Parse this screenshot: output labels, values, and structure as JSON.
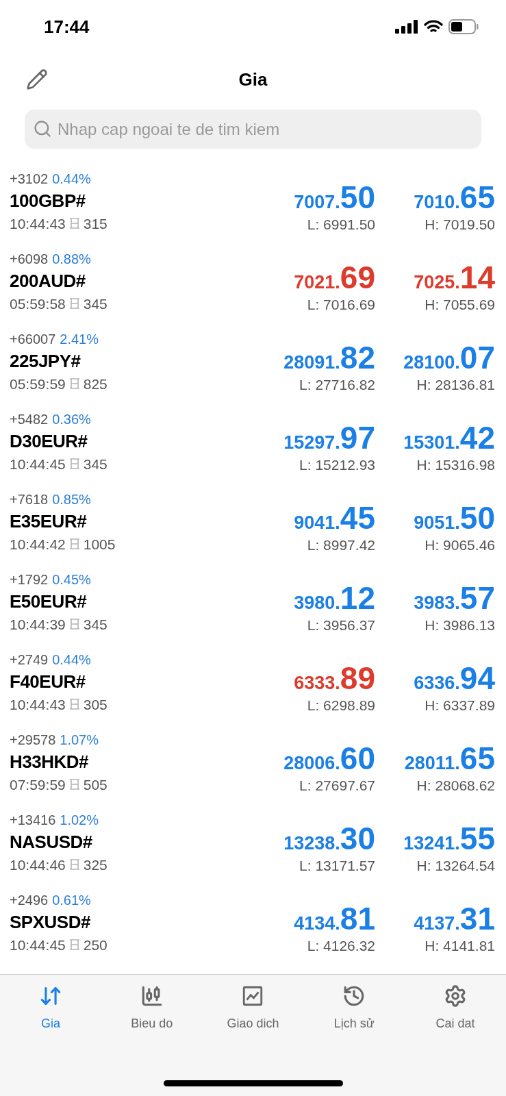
{
  "status_bar": {
    "time": "17:44"
  },
  "header": {
    "title": "Gia"
  },
  "search": {
    "placeholder": "Nhap cap ngoai te de tim kiem"
  },
  "quotes": [
    {
      "change": "+3102",
      "percent": "0.44%",
      "symbol": "100GBP#",
      "time": "10:44:43",
      "spread": "315",
      "bid": {
        "lead": "7007.",
        "big": "50",
        "rising": true
      },
      "ask": {
        "lead": "7010.",
        "big": "65",
        "rising": true
      },
      "low": "L: 6991.50",
      "high": "H: 7019.50"
    },
    {
      "change": "+6098",
      "percent": "0.88%",
      "symbol": "200AUD#",
      "time": "05:59:58",
      "spread": "345",
      "bid": {
        "lead": "7021.",
        "big": "69",
        "rising": false
      },
      "ask": {
        "lead": "7025.",
        "big": "14",
        "rising": false
      },
      "low": "L: 7016.69",
      "high": "H: 7055.69"
    },
    {
      "change": "+66007",
      "percent": "2.41%",
      "symbol": "225JPY#",
      "time": "05:59:59",
      "spread": "825",
      "bid": {
        "lead": "28091.",
        "big": "82",
        "rising": true
      },
      "ask": {
        "lead": "28100.",
        "big": "07",
        "rising": true
      },
      "low": "L: 27716.82",
      "high": "H: 28136.81"
    },
    {
      "change": "+5482",
      "percent": "0.36%",
      "symbol": "D30EUR#",
      "time": "10:44:45",
      "spread": "345",
      "bid": {
        "lead": "15297.",
        "big": "97",
        "rising": true
      },
      "ask": {
        "lead": "15301.",
        "big": "42",
        "rising": true
      },
      "low": "L: 15212.93",
      "high": "H: 15316.98"
    },
    {
      "change": "+7618",
      "percent": "0.85%",
      "symbol": "E35EUR#",
      "time": "10:44:42",
      "spread": "1005",
      "bid": {
        "lead": "9041.",
        "big": "45",
        "rising": true
      },
      "ask": {
        "lead": "9051.",
        "big": "50",
        "rising": true
      },
      "low": "L: 8997.42",
      "high": "H: 9065.46"
    },
    {
      "change": "+1792",
      "percent": "0.45%",
      "symbol": "E50EUR#",
      "time": "10:44:39",
      "spread": "345",
      "bid": {
        "lead": "3980.",
        "big": "12",
        "rising": true
      },
      "ask": {
        "lead": "3983.",
        "big": "57",
        "rising": true
      },
      "low": "L: 3956.37",
      "high": "H: 3986.13"
    },
    {
      "change": "+2749",
      "percent": "0.44%",
      "symbol": "F40EUR#",
      "time": "10:44:43",
      "spread": "305",
      "bid": {
        "lead": "6333.",
        "big": "89",
        "rising": false
      },
      "ask": {
        "lead": "6336.",
        "big": "94",
        "rising": true
      },
      "low": "L: 6298.89",
      "high": "H: 6337.89"
    },
    {
      "change": "+29578",
      "percent": "1.07%",
      "symbol": "H33HKD#",
      "time": "07:59:59",
      "spread": "505",
      "bid": {
        "lead": "28006.",
        "big": "60",
        "rising": true
      },
      "ask": {
        "lead": "28011.",
        "big": "65",
        "rising": true
      },
      "low": "L: 27697.67",
      "high": "H: 28068.62"
    },
    {
      "change": "+13416",
      "percent": "1.02%",
      "symbol": "NASUSD#",
      "time": "10:44:46",
      "spread": "325",
      "bid": {
        "lead": "13238.",
        "big": "30",
        "rising": true
      },
      "ask": {
        "lead": "13241.",
        "big": "55",
        "rising": true
      },
      "low": "L: 13171.57",
      "high": "H: 13264.54"
    },
    {
      "change": "+2496",
      "percent": "0.61%",
      "symbol": "SPXUSD#",
      "time": "10:44:45",
      "spread": "250",
      "bid": {
        "lead": "4134.",
        "big": "81",
        "rising": true
      },
      "ask": {
        "lead": "4137.",
        "big": "31",
        "rising": true
      },
      "low": "L: 4126.32",
      "high": "H: 4141.81"
    }
  ],
  "tab_bar": [
    {
      "label": "Gia",
      "selected": true
    },
    {
      "label": "Bieu do",
      "selected": false
    },
    {
      "label": "Giao dich",
      "selected": false
    },
    {
      "label": "Lịch sử",
      "selected": false
    },
    {
      "label": "Cai dat",
      "selected": false
    }
  ]
}
